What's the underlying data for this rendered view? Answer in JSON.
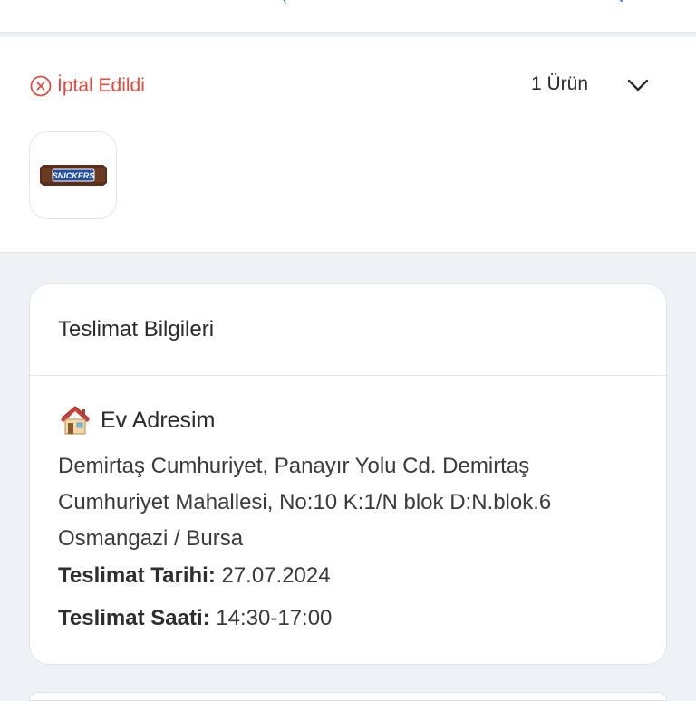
{
  "order": {
    "status_label": "İptal Edildi",
    "status_color": "#e5483c",
    "item_count_label": "1 Ürün",
    "product_image": "snickers-bar-image"
  },
  "delivery": {
    "section_title": "Teslimat Bilgileri",
    "address_title": "Ev Adresim",
    "address_icon": "house-icon",
    "address_line1": "Demirtaş Cumhuriyet, Panayır Yolu Cd. Demirtaş",
    "address_line2": "Cumhuriyet Mahallesi, No:10 K:1/N blok D:N.blok.6",
    "address_line3": "Osmangazi / Bursa",
    "date_label": "Teslimat Tarihi:",
    "date_value": "27.07.2024",
    "time_label": "Teslimat Saati:",
    "time_value": "14:30-17:00"
  },
  "colors": {
    "page_background": "#eef2f7",
    "card_background": "#ffffff",
    "accent_blue": "#4a90d9"
  }
}
